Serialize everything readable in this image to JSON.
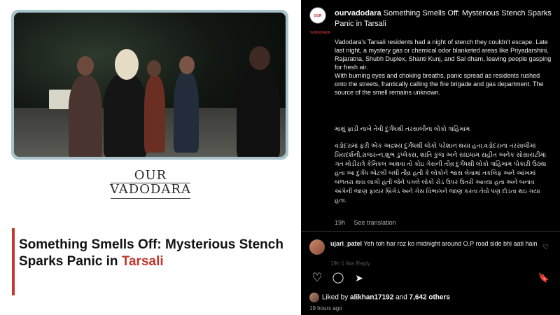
{
  "article": {
    "logo_line1": "OUR",
    "logo_line2": "VADODARA",
    "headline_main": "Something Smells Off: Mysterious Stench Sparks Panic in ",
    "headline_accent": "Tarsali"
  },
  "post": {
    "username": "ourvadodara",
    "avatar_text": "OUR VADODARA",
    "title": "Something Smells Off: Mysterious Stench Sparks Panic in Tarsali",
    "paragraph1": "Vadodara's Tarsali residents had a night of stench they couldn't escape. Late last night, a mystery gas or chemical odor blanketed areas like Priyadarshini, Rajaratna, Shubh Duplex, Shanti Kunj, and Sai dham, leaving people gasping for fresh air.",
    "paragraph2": "With burning eyes and choking breaths, panic spread as residents rushed onto the streets, frantically calling the fire brigade and gas department. The source of the smell remains unknown.",
    "gujarati_heading": "માથું ફાડી નાખે તેવી દુર્ગંધથી તરસાલીના લોકો ત્રાહિમામ",
    "gujarati_body": "વડોદરામાં ફરી એક અદ્રશ્ય દુર્ગંધથી લોકો પરેશાન થયા હતા.વડોદરાના તરસાલીમાં પ્રિયદર્શની,રાજરત્ન,શુભ ડુપ્લેક્સ, શાંતિ કુંજ અને સાંઇધામ સહીત અનેક સોસાયટીમાં ગત મોડીરાત્રે કેમિકલ અથવા તો કોઇ ગેસની તીવ્ર દુર્ગંધથી લોકો ત્રાહિમામ પોકારી ઉઠ્યા હતા આ દુર્ગંધ એટલી બધી તીવ્ર હતી કે લોકોને શ્વાસ લેવામાં તકલિફ અને આંખમાં બળતરા થવા લાગી હતી જેને પગલે લોકો રોડ ઉપર ઉતરી આવ્યા હતા અને બનાવ અંગેની જાણ ફાયર બ્રિગેડ અને ગેસ વિભાગને જાણ કરતા તેવો પણ દોડતા થઇ ગયા હતા.",
    "time": "19h",
    "see_translation": "See translation"
  },
  "comment": {
    "username": "ujari_patel",
    "text": "Yeh toh har roz ko midnight around O.P road side bhi aati hain",
    "heart_icon": "♡",
    "meta_faded": "19h   1 like   Reply"
  },
  "actions": {
    "like_icon": "♡",
    "comment_icon": "◯",
    "share_icon": "➤",
    "save_icon": "🔖"
  },
  "likes": {
    "prefix": "Liked by ",
    "user": "alikhan17192",
    "middle": " and ",
    "others": "7,642 others"
  },
  "timestamp": "19 hours ago"
}
